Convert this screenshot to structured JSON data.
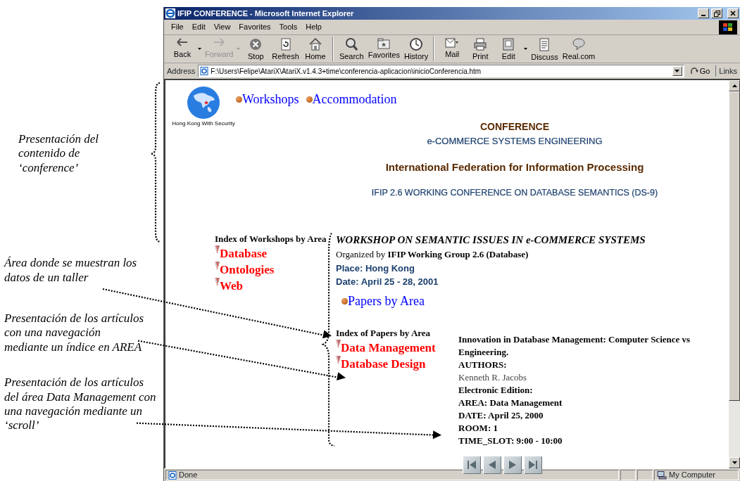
{
  "annotations": [
    {
      "text": "Presentación del contenido de ‘conference’"
    },
    {
      "text": "Área donde se muestran los datos de un taller"
    },
    {
      "text": "Presentación de los artículos con una navegación mediante un índice en AREA"
    },
    {
      "text": "Presentación de los artículos del área Data Management con una navegación mediante un ‘scroll’"
    }
  ],
  "window": {
    "title": "IFIP CONFERENCE - Microsoft Internet Explorer"
  },
  "menu": [
    "File",
    "Edit",
    "View",
    "Favorites",
    "Tools",
    "Help"
  ],
  "toolbar": {
    "groups": [
      {
        "buttons": [
          {
            "label": "Back",
            "disabled": false,
            "dropdown": true
          },
          {
            "label": "Forward",
            "disabled": true,
            "dropdown": true
          },
          {
            "label": "Stop",
            "disabled": false,
            "dropdown": false
          },
          {
            "label": "Refresh",
            "disabled": false,
            "dropdown": false
          },
          {
            "label": "Home",
            "disabled": false,
            "dropdown": false
          }
        ]
      },
      {
        "buttons": [
          {
            "label": "Search",
            "disabled": false,
            "dropdown": false
          },
          {
            "label": "Favorites",
            "disabled": false,
            "dropdown": false
          },
          {
            "label": "History",
            "disabled": false,
            "dropdown": false
          }
        ]
      },
      {
        "buttons": [
          {
            "label": "Mail",
            "disabled": false,
            "dropdown": false
          },
          {
            "label": "Print",
            "disabled": false,
            "dropdown": false
          },
          {
            "label": "Edit",
            "disabled": false,
            "dropdown": true
          },
          {
            "label": "Discuss",
            "disabled": false,
            "dropdown": false
          },
          {
            "label": "Real.com",
            "disabled": false,
            "dropdown": false
          }
        ]
      }
    ]
  },
  "address": {
    "label": "Address",
    "value": "F:\\Users\\Felipe\\AtariX\\AtariX.v1.4.3+time\\conferencia-aplicacion\\inicioConferencia.htm",
    "go": "Go",
    "links": "Links"
  },
  "page": {
    "logo_caption": "Hong Kong With Security",
    "nav_links": [
      "Workshops",
      "Accommodation"
    ],
    "headings": [
      {
        "text": "CONFERENCE",
        "kind": "title"
      },
      {
        "text": "e-COMMERCE SYSTEMS ENGINEERING",
        "kind": "subtitle"
      },
      {
        "text": "International Federation for Information Processing",
        "kind": "org"
      },
      {
        "text": "IFIP 2.6 WORKING CONFERENCE ON DATABASE SEMANTICS (DS-9)",
        "kind": "event"
      }
    ],
    "workshop_index": {
      "heading": "Index of Workshops by Area",
      "items": [
        "Database",
        "Ontologies",
        "Web"
      ]
    },
    "workshop": {
      "title": "WORKSHOP ON SEMANTIC ISSUES IN e-COMMERCE SYSTEMS",
      "organized": "Organized by **IFIP Working Group 2.6 (Database)**",
      "place": "Place: Hong Kong",
      "date": "Date: April 25 - 28, 2001",
      "papers_link": "Papers by Area"
    },
    "paper_index": {
      "heading": "Index of Papers by Area",
      "items": [
        "Data Management",
        "Database Design"
      ]
    },
    "paper": {
      "lines": [
        {
          "text": "Innovation in Database Management: Computer Science vs Engineering.",
          "kind": "bold"
        },
        {
          "text": "AUTHORS:",
          "kind": "bold"
        },
        {
          "text": "Kenneth R. Jacobs",
          "kind": "plain"
        },
        {
          "text": "Electronic Edition:",
          "kind": "bold"
        },
        {
          "text": "AREA: Data Management",
          "kind": "bold"
        },
        {
          "text": "DATE: April 25, 2000",
          "kind": "bold"
        },
        {
          "text": "ROOM: 1",
          "kind": "bold"
        },
        {
          "text": "TIME_SLOT: 9:00 - 10:00",
          "kind": "bold"
        }
      ]
    }
  },
  "status_bar": {
    "text": "Done",
    "zone": "My Computer"
  }
}
